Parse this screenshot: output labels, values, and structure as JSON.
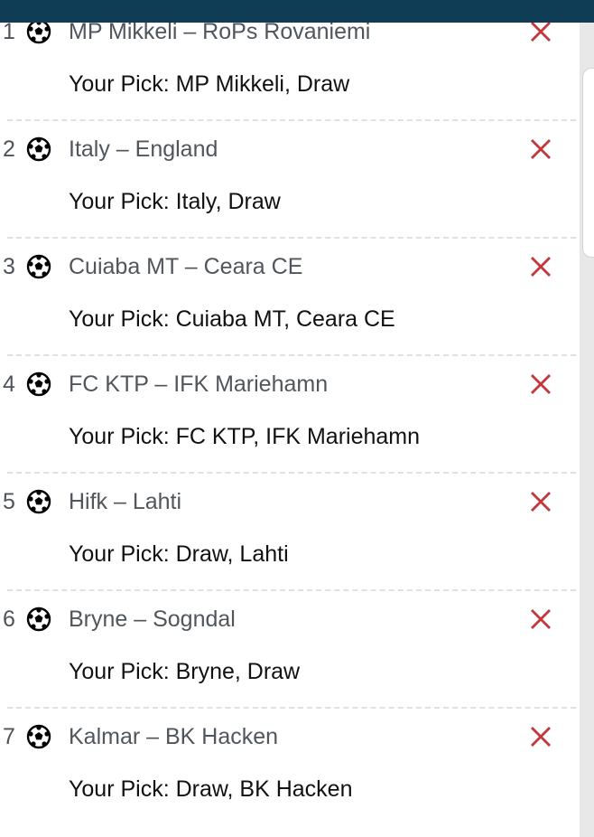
{
  "colors": {
    "header": "#0f3d55",
    "remove": "#c4383c",
    "matchText": "#50565b",
    "pickText": "#111111"
  },
  "icons": {
    "sport": "soccer-ball-icon",
    "remove": "close-icon"
  },
  "picks": [
    {
      "number": "1",
      "match": "MP Mikkeli – RoPs Rovaniemi",
      "pick": "Your Pick: MP Mikkeli, Draw"
    },
    {
      "number": "2",
      "match": "Italy – England",
      "pick": "Your Pick: Italy, Draw"
    },
    {
      "number": "3",
      "match": "Cuiaba MT – Ceara CE",
      "pick": "Your Pick: Cuiaba MT, Ceara CE"
    },
    {
      "number": "4",
      "match": "FC KTP – IFK Mariehamn",
      "pick": "Your Pick: FC KTP, IFK Mariehamn"
    },
    {
      "number": "5",
      "match": "Hifk – Lahti",
      "pick": "Your Pick: Draw, Lahti"
    },
    {
      "number": "6",
      "match": "Bryne – Sogndal",
      "pick": "Your Pick: Bryne, Draw"
    },
    {
      "number": "7",
      "match": "Kalmar – BK Hacken",
      "pick": "Your Pick: Draw, BK Hacken"
    }
  ]
}
